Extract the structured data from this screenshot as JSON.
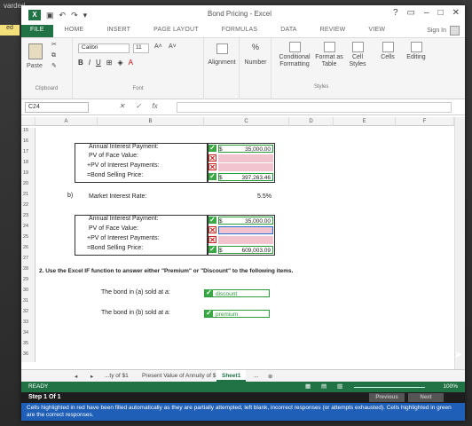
{
  "top_strip": "varded",
  "side_tab": "ed",
  "window": {
    "title": "Bond Pricing - Excel",
    "controls": [
      "?",
      "–",
      "✕"
    ]
  },
  "ribbon_tabs": [
    "FILE",
    "HOME",
    "INSERT",
    "PAGE LAYOUT",
    "FORMULAS",
    "DATA",
    "REVIEW",
    "VIEW"
  ],
  "sign_in": "Sign In",
  "ribbon": {
    "paste": "Paste",
    "clipboard": "Clipboard",
    "font_name": "Calibri",
    "font_size": "11",
    "bold": "B",
    "italic": "I",
    "underline": "U",
    "font_group": "Font",
    "alignment": "Alignment",
    "number": "Number",
    "number_symbol": "%",
    "conditional": "Conditional Formatting",
    "format_table": "Format as Table",
    "cell_styles": "Cell Styles",
    "cells": "Cells",
    "editing": "Editing",
    "styles_group": "Styles"
  },
  "formula_bar": {
    "name_box": "C24",
    "fx": "fx"
  },
  "columns": [
    "A",
    "B",
    "C",
    "D",
    "E",
    "F"
  ],
  "rows": [
    "15",
    "16",
    "17",
    "18",
    "19",
    "20",
    "21",
    "22",
    "23",
    "24",
    "25",
    "26",
    "27",
    "28",
    "29",
    "30",
    "31",
    "32",
    "33",
    "34",
    "35",
    "36"
  ],
  "section_a": {
    "annual": "Annual Interest Payment:",
    "annual_currency": "$",
    "annual_value": "35,000.00",
    "pv_face": "PV of Face Value:",
    "pv_interest": "+PV of Interest Payments:",
    "selling": "=Bond Selling Price:",
    "selling_currency": "$",
    "selling_value": "397,263.46"
  },
  "section_b": {
    "tag": "b)",
    "market_rate_label": "Market Interest Rate:",
    "market_rate": "5.5%",
    "annual": "Annual Interest Payment:",
    "annual_currency": "$",
    "annual_value": "35,000.00",
    "pv_face": "PV of Face Value:",
    "pv_interest": "+PV of Interest Payments:",
    "selling": "=Bond Selling Price:",
    "selling_currency": "$",
    "selling_value": "609,003.09"
  },
  "question": "2. Use the Excel IF function to answer either \"Premium\" or \"Discount\" to the following items.",
  "answers": {
    "a_label": "The bond in (a) sold at a:",
    "a_value": "discount",
    "b_label": "The bond in (b) sold at a:",
    "b_value": "premium"
  },
  "sheet_tabs": {
    "prev_sheet": "...ty of $1",
    "sheet2": "Present Value of Annuity of $1",
    "active": "Sheet1",
    "more": "..."
  },
  "status": {
    "ready": "READY",
    "zoom": "100%"
  },
  "step": {
    "label": "Step 1 Of 1",
    "previous": "Previous",
    "next": "Next",
    "message": "Cells highlighted in red have been filled automatically as they are partially attempted, left blank, incorrect responses (or attempts exhausted). Cells highlighted in green are the correct responses."
  },
  "colors": {
    "excel_green": "#217346",
    "correct_green": "#3aa845",
    "incorrect_red": "#d02020",
    "pink_fill": "#f2c4cf",
    "message_blue": "#1f5fb8"
  }
}
